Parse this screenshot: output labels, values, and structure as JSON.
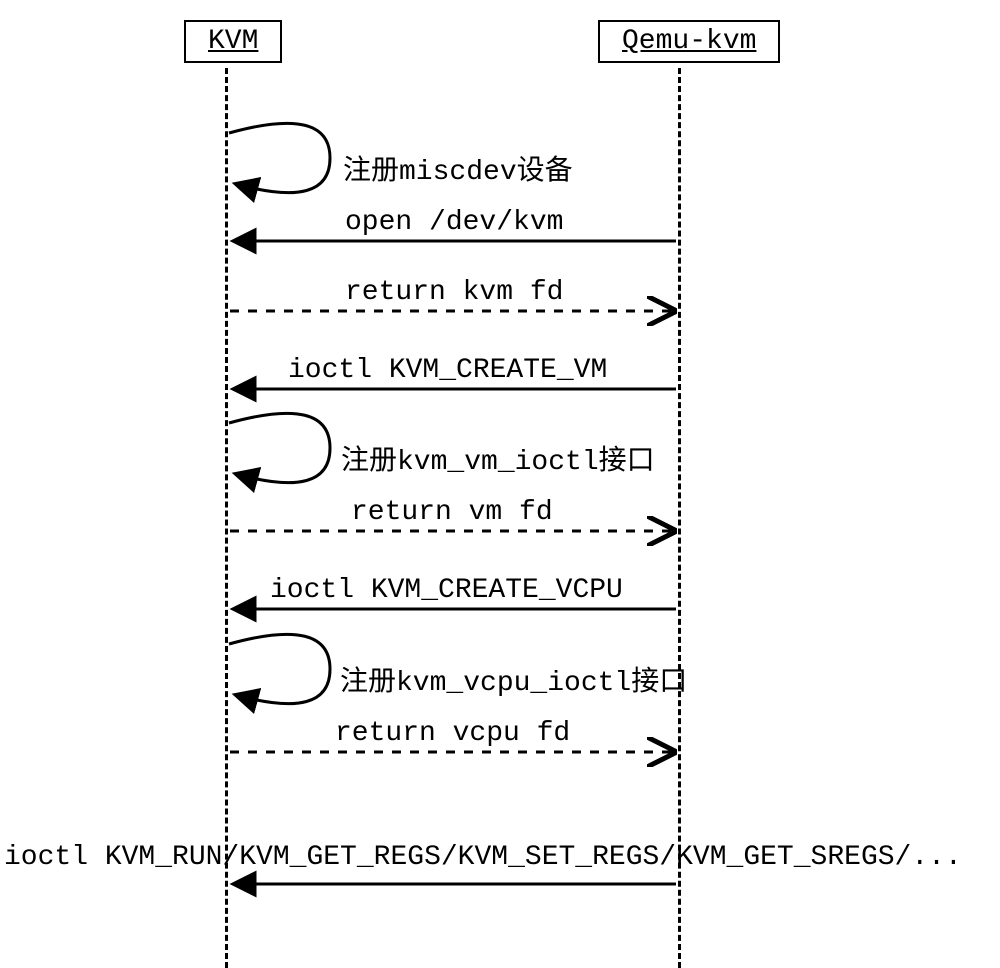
{
  "participants": {
    "left": "KVM",
    "right": "Qemu-kvm"
  },
  "messages": {
    "self1": "注册miscdev设备",
    "open": "open /dev/kvm",
    "ret_kvm": "return kvm fd",
    "create_vm": "ioctl KVM_CREATE_VM",
    "self2": "注册kvm_vm_ioctl接口",
    "ret_vm": "return vm fd",
    "create_vcpu": "ioctl KVM_CREATE_VCPU",
    "self3": "注册kvm_vcpu_ioctl接口",
    "ret_vcpu": "return vcpu fd",
    "final": "ioctl KVM_RUN/KVM_GET_REGS/KVM_SET_REGS/KVM_GET_SREGS/..."
  }
}
